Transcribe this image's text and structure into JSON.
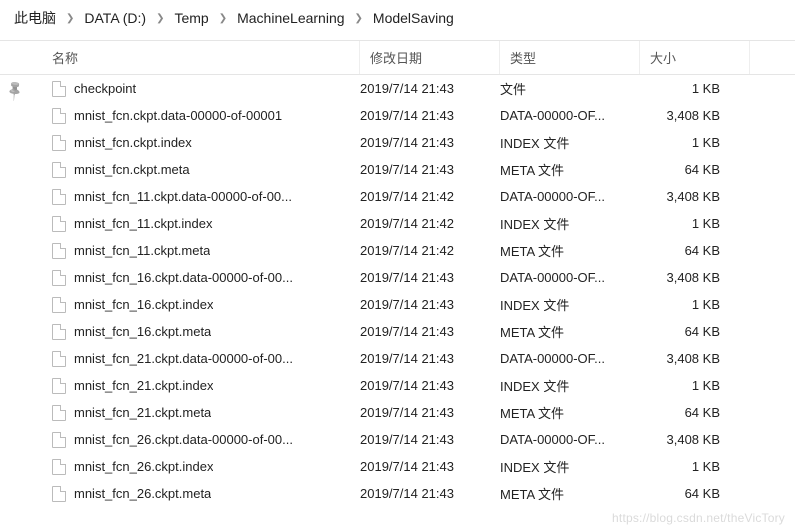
{
  "breadcrumb": [
    {
      "label": "此电脑"
    },
    {
      "label": "DATA (D:)"
    },
    {
      "label": "Temp"
    },
    {
      "label": "MachineLearning"
    },
    {
      "label": "ModelSaving"
    }
  ],
  "columns": {
    "name": "名称",
    "date": "修改日期",
    "type": "类型",
    "size": "大小"
  },
  "files": [
    {
      "name": "checkpoint",
      "date": "2019/7/14 21:43",
      "type": "文件",
      "size": "1 KB"
    },
    {
      "name": "mnist_fcn.ckpt.data-00000-of-00001",
      "date": "2019/7/14 21:43",
      "type": "DATA-00000-OF...",
      "size": "3,408 KB"
    },
    {
      "name": "mnist_fcn.ckpt.index",
      "date": "2019/7/14 21:43",
      "type": "INDEX 文件",
      "size": "1 KB"
    },
    {
      "name": "mnist_fcn.ckpt.meta",
      "date": "2019/7/14 21:43",
      "type": "META 文件",
      "size": "64 KB"
    },
    {
      "name": "mnist_fcn_11.ckpt.data-00000-of-00...",
      "date": "2019/7/14 21:42",
      "type": "DATA-00000-OF...",
      "size": "3,408 KB"
    },
    {
      "name": "mnist_fcn_11.ckpt.index",
      "date": "2019/7/14 21:42",
      "type": "INDEX 文件",
      "size": "1 KB"
    },
    {
      "name": "mnist_fcn_11.ckpt.meta",
      "date": "2019/7/14 21:42",
      "type": "META 文件",
      "size": "64 KB"
    },
    {
      "name": "mnist_fcn_16.ckpt.data-00000-of-00...",
      "date": "2019/7/14 21:43",
      "type": "DATA-00000-OF...",
      "size": "3,408 KB"
    },
    {
      "name": "mnist_fcn_16.ckpt.index",
      "date": "2019/7/14 21:43",
      "type": "INDEX 文件",
      "size": "1 KB"
    },
    {
      "name": "mnist_fcn_16.ckpt.meta",
      "date": "2019/7/14 21:43",
      "type": "META 文件",
      "size": "64 KB"
    },
    {
      "name": "mnist_fcn_21.ckpt.data-00000-of-00...",
      "date": "2019/7/14 21:43",
      "type": "DATA-00000-OF...",
      "size": "3,408 KB"
    },
    {
      "name": "mnist_fcn_21.ckpt.index",
      "date": "2019/7/14 21:43",
      "type": "INDEX 文件",
      "size": "1 KB"
    },
    {
      "name": "mnist_fcn_21.ckpt.meta",
      "date": "2019/7/14 21:43",
      "type": "META 文件",
      "size": "64 KB"
    },
    {
      "name": "mnist_fcn_26.ckpt.data-00000-of-00...",
      "date": "2019/7/14 21:43",
      "type": "DATA-00000-OF...",
      "size": "3,408 KB"
    },
    {
      "name": "mnist_fcn_26.ckpt.index",
      "date": "2019/7/14 21:43",
      "type": "INDEX 文件",
      "size": "1 KB"
    },
    {
      "name": "mnist_fcn_26.ckpt.meta",
      "date": "2019/7/14 21:43",
      "type": "META 文件",
      "size": "64 KB"
    }
  ],
  "watermark": "https://blog.csdn.net/theVicTory"
}
